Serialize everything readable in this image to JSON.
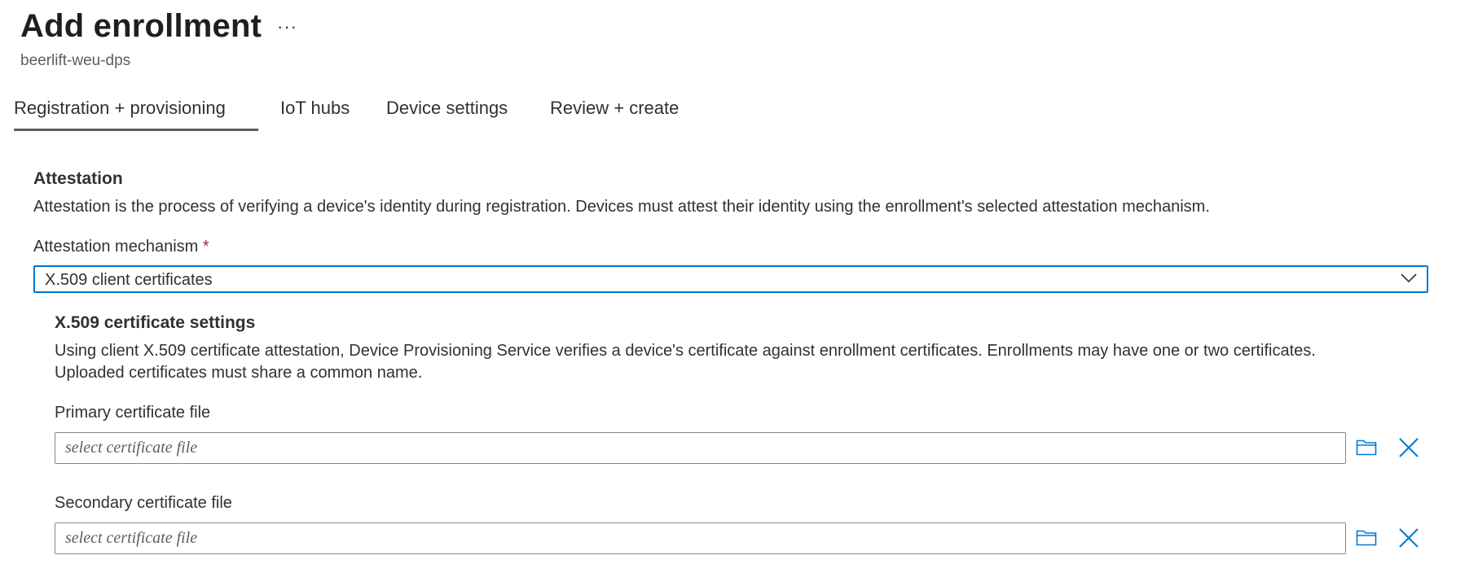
{
  "header": {
    "title": "Add enrollment",
    "more_label": "···",
    "subtitle": "beerlift-weu-dps"
  },
  "tabs": [
    {
      "label": "Registration + provisioning",
      "active": true
    },
    {
      "label": "IoT hubs",
      "active": false
    },
    {
      "label": "Device settings",
      "active": false
    },
    {
      "label": "Review + create",
      "active": false
    }
  ],
  "attestation": {
    "title": "Attestation",
    "description": "Attestation is the process of verifying a device's identity during registration. Devices must attest their identity using the enrollment's selected attestation mechanism.",
    "mechanism_label": "Attestation mechanism",
    "required_mark": "*",
    "mechanism_value": "X.509 client certificates"
  },
  "x509": {
    "title": "X.509 certificate settings",
    "description_line1": "Using client X.509 certificate attestation, Device Provisioning Service verifies a device's certificate against enrollment certificates. Enrollments may have one or two certificates.",
    "description_line2": "Uploaded certificates must share a common name.",
    "primary": {
      "label": "Primary certificate file",
      "value": "",
      "placeholder": "select certificate file"
    },
    "secondary": {
      "label": "Secondary certificate file",
      "value": "",
      "placeholder": "select certificate file"
    }
  },
  "icons": {
    "browse": "folder-icon",
    "clear": "close-icon",
    "dropdown": "chevron-down-icon"
  },
  "colors": {
    "accent": "#0078d4",
    "required": "#a4262c",
    "text": "#323130",
    "border": "#8a8886"
  }
}
